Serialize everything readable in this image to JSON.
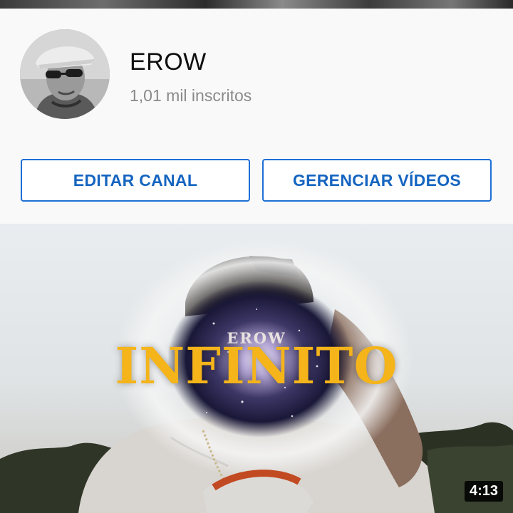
{
  "channel": {
    "name": "EROW",
    "subscribers": "1,01 mil inscritos"
  },
  "actions": {
    "edit_label": "EDITAR CANAL",
    "manage_label": "GERENCIAR VÍDEOS"
  },
  "video": {
    "thumbnail_artist": "EROW",
    "thumbnail_title": "INFINITO",
    "duration": "4:13"
  },
  "colors": {
    "accent": "#1565c0",
    "title_gold": "#f4b41a"
  }
}
